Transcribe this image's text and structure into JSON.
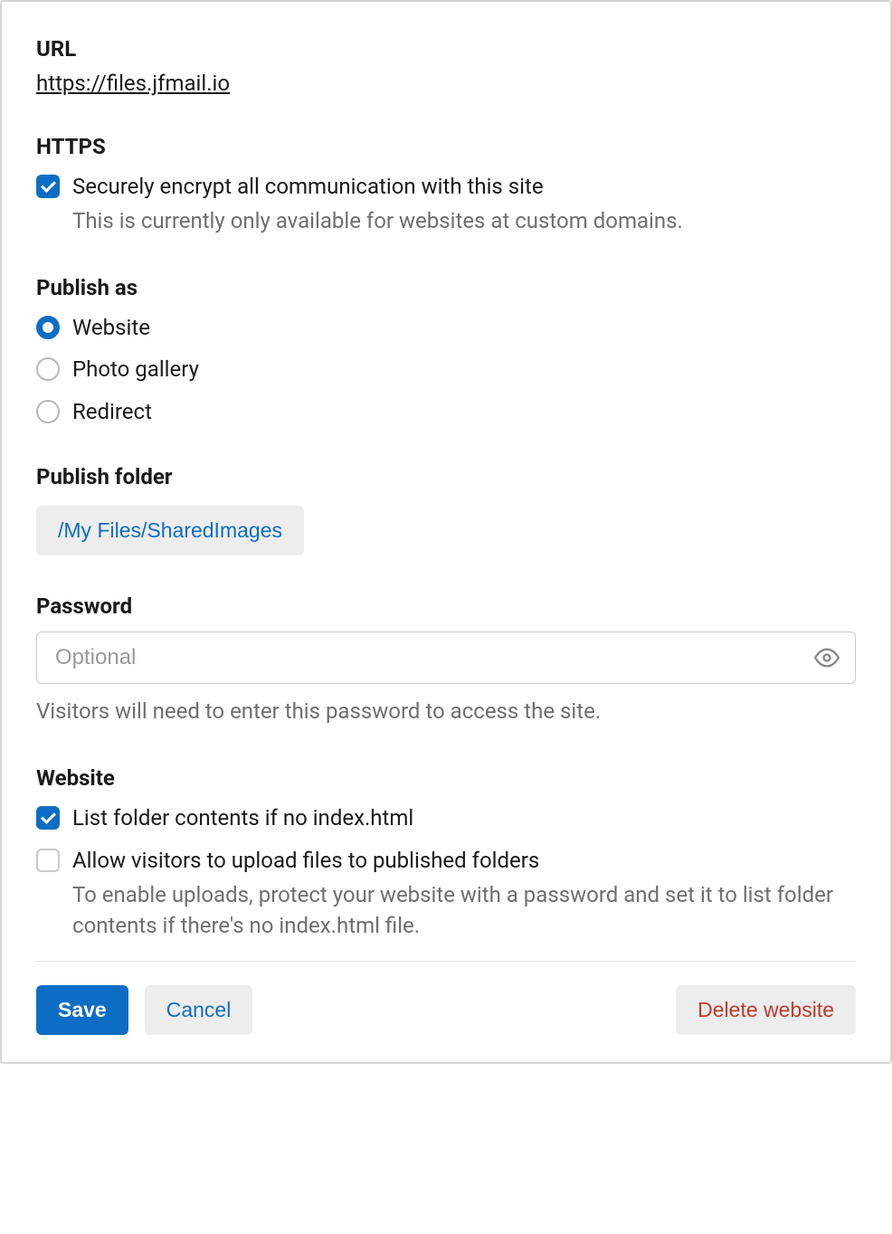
{
  "url": {
    "label": "URL",
    "value": "https://files.jfmail.io"
  },
  "https": {
    "label": "HTTPS",
    "option_label": "Securely encrypt all communication with this site",
    "help": "This is currently only available for websites at custom domains.",
    "checked": true
  },
  "publish_as": {
    "label": "Publish as",
    "options": [
      {
        "label": "Website",
        "selected": true
      },
      {
        "label": "Photo gallery",
        "selected": false
      },
      {
        "label": "Redirect",
        "selected": false
      }
    ]
  },
  "publish_folder": {
    "label": "Publish folder",
    "path": "/My Files/SharedImages"
  },
  "password": {
    "label": "Password",
    "placeholder": "Optional",
    "help": "Visitors will need to enter this password to access the site."
  },
  "website": {
    "label": "Website",
    "list_contents": {
      "label": "List folder contents if no index.html",
      "checked": true
    },
    "allow_upload": {
      "label": "Allow visitors to upload files to published folders",
      "help": "To enable uploads, protect your website with a password and set it to list folder contents if there's no index.html file.",
      "checked": false
    }
  },
  "footer": {
    "save": "Save",
    "cancel": "Cancel",
    "delete": "Delete website"
  }
}
